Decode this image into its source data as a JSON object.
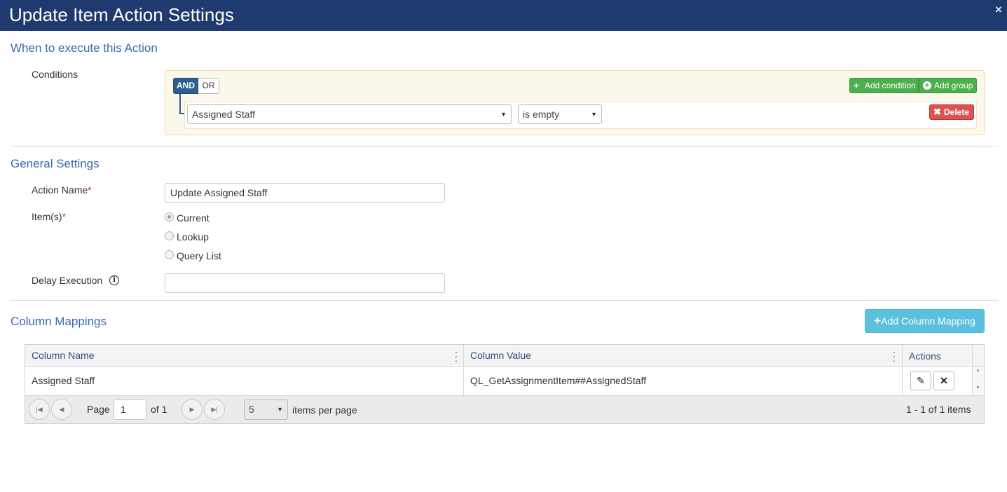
{
  "dialog": {
    "title": "Update Item Action Settings",
    "close_label": "×"
  },
  "when_section": {
    "title": "When to execute this Action",
    "conditions_label": "Conditions",
    "and_label": "AND",
    "or_label": "OR",
    "add_condition_label": "Add condition",
    "add_group_label": "Add group",
    "rule": {
      "field_value": "Assigned Staff",
      "operator_value": "is empty",
      "delete_label": "Delete"
    }
  },
  "general_section": {
    "title": "General Settings",
    "action_name_label": "Action Name",
    "action_name_value": "Update Assigned Staff",
    "items_label": "Item(s)",
    "required_marker": "*",
    "item_options": [
      "Current",
      "Lookup",
      "Query List"
    ],
    "selected_item": "Current",
    "delay_label": "Delay Execution",
    "delay_value": ""
  },
  "mappings_section": {
    "title": "Column Mappings",
    "add_mapping_label": "Add Column Mapping",
    "columns": [
      "Column Name",
      "Column Value",
      "Actions"
    ],
    "rows": [
      {
        "column_name": "Assigned Staff",
        "column_value": "QL_GetAssignmentItem##AssignedStaff"
      }
    ],
    "pager": {
      "page_label": "Page",
      "page_value": "1",
      "of_label": "of 1",
      "page_size": "5",
      "per_page_label": "items per page",
      "summary": "1 - 1 of 1 items"
    }
  },
  "colors": {
    "header_bg": "#1f3a6e",
    "section_title": "#3a6ab0",
    "green_button": "#4cae4c",
    "red_button": "#d9534f",
    "blue_button": "#5bc0de",
    "condition_panel_bg": "#fcf8ec"
  }
}
